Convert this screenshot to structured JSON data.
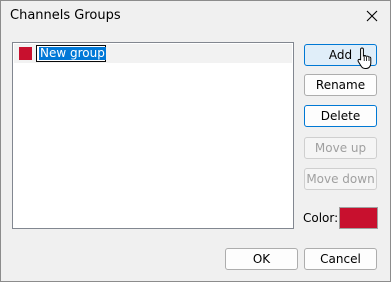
{
  "window": {
    "title": "Channels Groups"
  },
  "list": {
    "items": [
      {
        "label": "New group",
        "color": "#c8102e"
      }
    ]
  },
  "buttons": {
    "add": "Add",
    "rename": "Rename",
    "delete": "Delete",
    "move_up": "Move up",
    "move_down": "Move down",
    "ok": "OK",
    "cancel": "Cancel"
  },
  "color_field": {
    "label": "Color:",
    "value": "#c8102e"
  },
  "colors": {
    "accent": "#0078d4",
    "selection": "#0078d7",
    "swatch": "#c8102e"
  },
  "icons": {
    "close": "close-icon",
    "cursor": "mouse-pointer-icon"
  }
}
